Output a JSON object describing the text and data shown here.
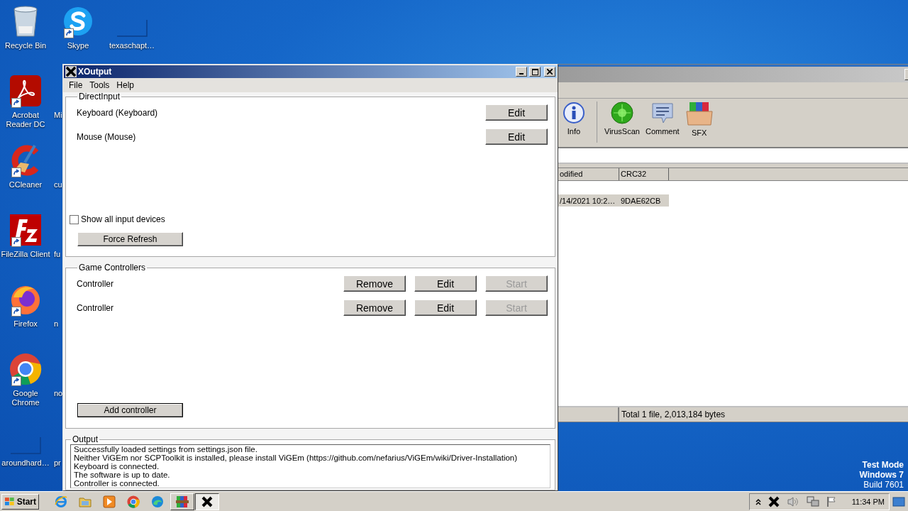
{
  "desktop_icons": [
    {
      "label": "Recycle Bin",
      "kind": "recycle-bin",
      "shortcut": false
    },
    {
      "label": "Skype",
      "kind": "skype",
      "shortcut": true
    },
    {
      "label": "texaschapt…",
      "kind": "thumbnail",
      "shortcut": false
    },
    {
      "label": "Acrobat Reader DC",
      "kind": "acrobat",
      "shortcut": true
    },
    {
      "label": "Mi",
      "kind": "covered"
    },
    {
      "label": "CCleaner",
      "kind": "ccleaner",
      "shortcut": true
    },
    {
      "label": "cu",
      "kind": "covered"
    },
    {
      "label": "FileZilla Client",
      "kind": "filezilla",
      "shortcut": true
    },
    {
      "label": "fu",
      "kind": "covered"
    },
    {
      "label": "Firefox",
      "kind": "firefox",
      "shortcut": true
    },
    {
      "label": "n",
      "kind": "covered"
    },
    {
      "label": "Google Chrome",
      "kind": "chrome",
      "shortcut": true
    },
    {
      "label": "no",
      "kind": "covered"
    },
    {
      "label": "aroundhard…",
      "kind": "thumbnail",
      "shortcut": false
    },
    {
      "label": "pr",
      "kind": "covered"
    }
  ],
  "archive_window": {
    "toolbar": [
      {
        "label": "Info",
        "kind": "info"
      },
      {
        "label": "VirusScan",
        "kind": "virus"
      },
      {
        "label": "Comment",
        "kind": "comment"
      },
      {
        "label": "SFX",
        "kind": "sfx"
      }
    ],
    "columns": [
      "odified",
      "CRC32"
    ],
    "rows": [
      {
        "cells": [
          "/14/2021 10:2…",
          "9DAE62CB"
        ],
        "selected": true
      }
    ],
    "status": "Total 1 file, 2,013,184 bytes"
  },
  "xoutput": {
    "title": "XOutput",
    "menu": [
      "File",
      "Tools",
      "Help"
    ],
    "direct_input": {
      "legend": "DirectInput",
      "devices": [
        {
          "name": "Keyboard (Keyboard)",
          "button": "Edit"
        },
        {
          "name": "Mouse (Mouse)",
          "button": "Edit"
        }
      ],
      "show_all": {
        "label": "Show all input devices",
        "checked": false
      },
      "refresh_button": "Force Refresh"
    },
    "game_controllers": {
      "legend": "Game Controllers",
      "controllers": [
        {
          "name": "Controller",
          "buttons": [
            {
              "label": "Remove",
              "disabled": false
            },
            {
              "label": "Edit",
              "disabled": false
            },
            {
              "label": "Start",
              "disabled": true
            }
          ]
        },
        {
          "name": "Controller",
          "buttons": [
            {
              "label": "Remove",
              "disabled": false
            },
            {
              "label": "Edit",
              "disabled": false
            },
            {
              "label": "Start",
              "disabled": true
            }
          ]
        }
      ],
      "add_button": "Add controller"
    },
    "output": {
      "legend": "Output",
      "lines": [
        "Successfully loaded settings from settings.json file.",
        "Neither ViGEm nor SCPToolkit is installed, please install ViGEm (https://github.com/nefarius/ViGEm/wiki/Driver-Installation)",
        "Keyboard is connected.",
        "The software is up to date.",
        "Controller is connected."
      ]
    }
  },
  "system_notice": [
    {
      "text": "Test Mode",
      "emphasis": true
    },
    {
      "text": "Windows 7",
      "emphasis": true
    },
    {
      "text": "Build 7601",
      "emphasis": false
    }
  ],
  "taskbar": {
    "start": "Start",
    "quick_launch": [
      {
        "kind": "ie"
      },
      {
        "kind": "folder"
      },
      {
        "kind": "media"
      },
      {
        "kind": "chrome"
      },
      {
        "kind": "edge"
      }
    ],
    "tasks": [
      {
        "kind": "winrar",
        "selected": false
      },
      {
        "kind": "xoutput",
        "selected": true
      }
    ],
    "tray": [
      {
        "kind": "chevron"
      },
      {
        "kind": "xoutput"
      },
      {
        "kind": "speaker"
      },
      {
        "kind": "network"
      },
      {
        "kind": "flag"
      }
    ],
    "clock": "11:34 PM"
  }
}
